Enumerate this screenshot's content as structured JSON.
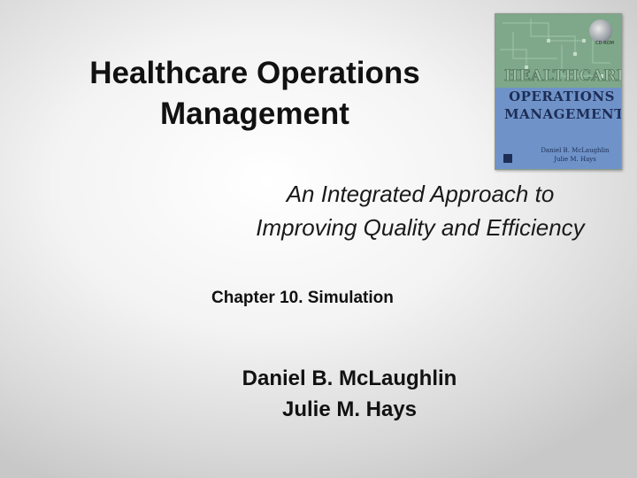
{
  "slide": {
    "title_line1": "Healthcare Operations",
    "title_line2": "Management",
    "subtitle_line1": "An Integrated Approach to",
    "subtitle_line2": "Improving Quality and Efficiency",
    "chapter": "Chapter 10. Simulation",
    "author1": "Daniel B. McLaughlin",
    "author2": "Julie M. Hays"
  },
  "cover": {
    "title_line1": "HEALTHCARE",
    "title_line2": "OPERATIONS",
    "title_line3": "MANAGEMENT",
    "author1": "Daniel B. McLaughlin",
    "author2": "Julie M. Hays",
    "badge": "CD-ROM",
    "colors": {
      "top": "#7fa88a",
      "bottom": "#6f93c9",
      "title": "#1e2d55"
    }
  }
}
